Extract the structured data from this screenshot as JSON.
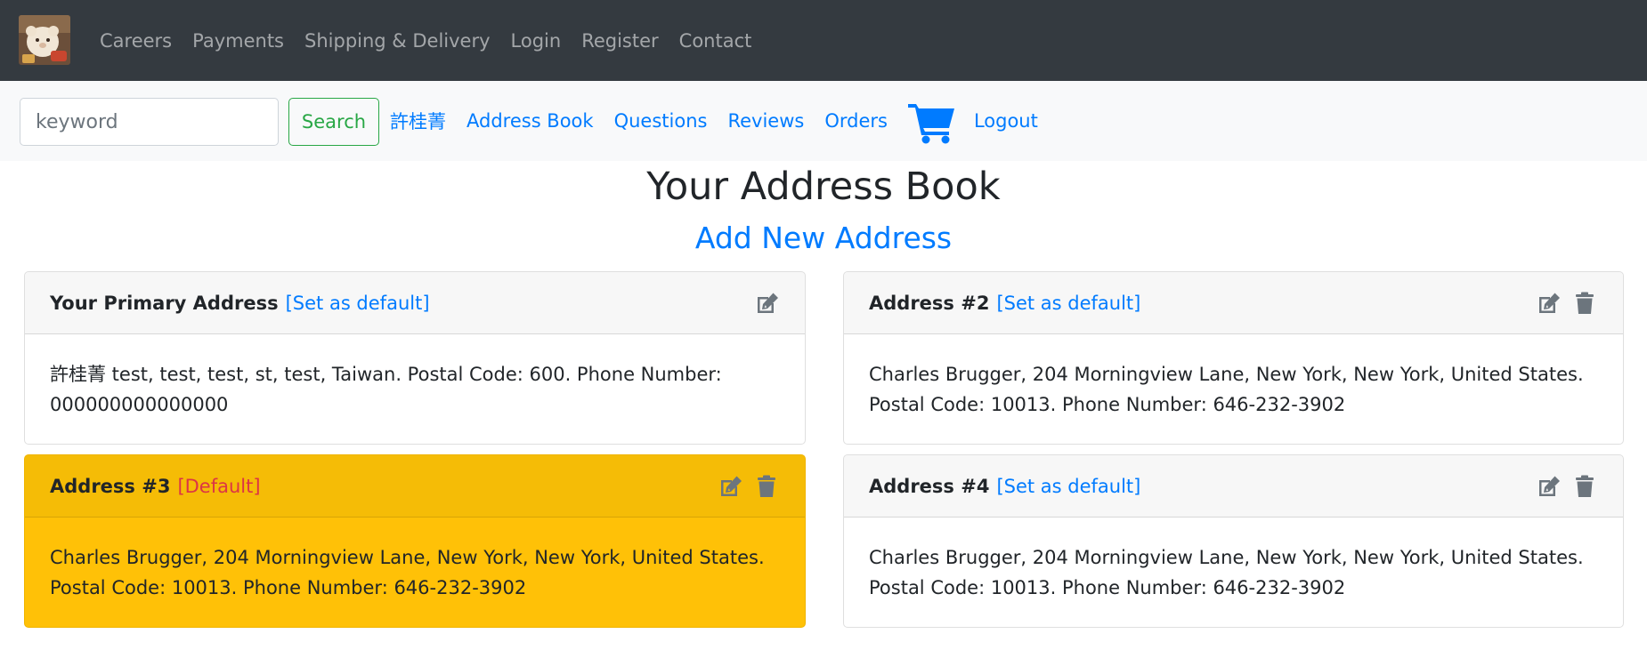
{
  "topnav": {
    "items": [
      "Careers",
      "Payments",
      "Shipping & Delivery",
      "Login",
      "Register",
      "Contact"
    ]
  },
  "subnav": {
    "search_placeholder": "keyword",
    "search_label": "Search",
    "user_name": "許桂菁",
    "items": [
      "Address Book",
      "Questions",
      "Reviews",
      "Orders"
    ],
    "logout": "Logout"
  },
  "page": {
    "title": "Your Address Book",
    "add_link": "Add New Address"
  },
  "addresses": [
    {
      "title": "Your Primary Address",
      "tag": "[Set as default]",
      "text": "許桂菁 test, test, test, st, test, Taiwan. Postal Code: 600. Phone Number: 000000000000000"
    },
    {
      "title": "Address #2",
      "tag": "[Set as default]",
      "text": "Charles Brugger, 204 Morningview Lane, New York, New York, United States. Postal Code: 10013. Phone Number: 646-232-3902"
    },
    {
      "title": "Address #3",
      "tag": "[Default]",
      "text": "Charles Brugger, 204 Morningview Lane, New York, New York, United States. Postal Code: 10013. Phone Number: 646-232-3902"
    },
    {
      "title": "Address #4",
      "tag": "[Set as default]",
      "text": "Charles Brugger, 204 Morningview Lane, New York, New York, United States. Postal Code: 10013. Phone Number: 646-232-3902"
    }
  ],
  "icons": {
    "edit": "edit-icon",
    "delete": "trash-icon",
    "cart": "cart-icon",
    "logo": "logo-image"
  },
  "colors": {
    "navbar_dark": "#343a40",
    "link_blue": "#007bff",
    "search_green": "#28a745",
    "default_card": "#ffc107",
    "default_tag_red": "#dc3545"
  }
}
